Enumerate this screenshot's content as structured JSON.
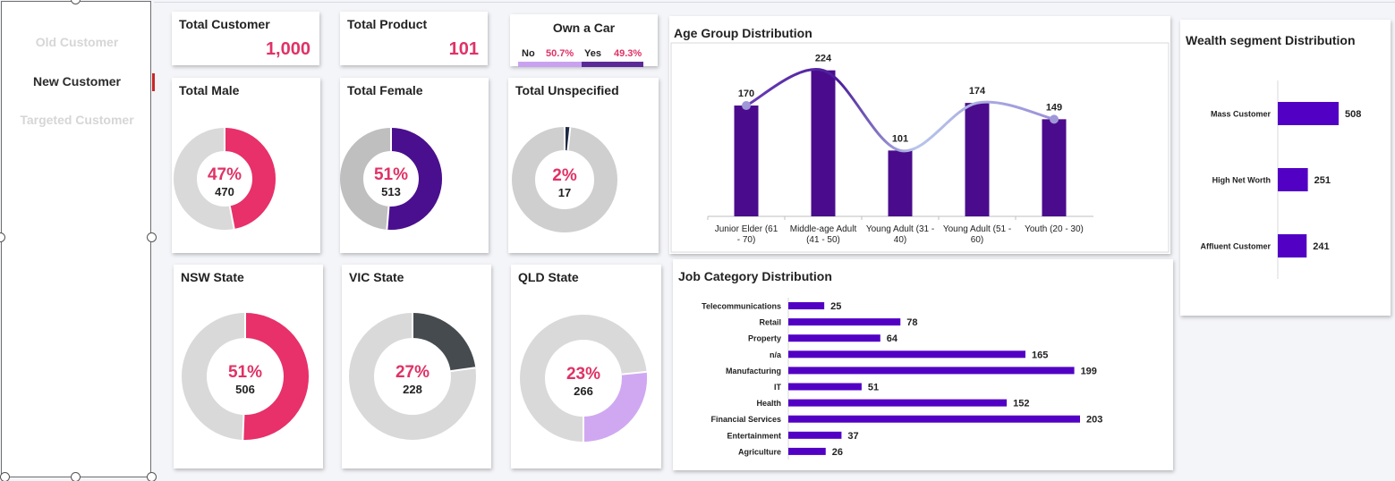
{
  "slicer": {
    "items": [
      {
        "label": "Old Customer",
        "state": "unselected"
      },
      {
        "label": "New Customer",
        "state": "selected"
      },
      {
        "label": "Targeted Customer",
        "state": "unselected"
      }
    ]
  },
  "kpis": {
    "total_customer": {
      "title": "Total Customer",
      "value": "1,000"
    },
    "total_product": {
      "title": "Total Product",
      "value": "101"
    }
  },
  "car": {
    "title": "Own a Car",
    "no_label": "No",
    "no_pct": "50.7%",
    "yes_label": "Yes",
    "yes_pct": "49.3%",
    "no_value": 50.7,
    "yes_value": 49.3
  },
  "donuts": {
    "male": {
      "title": "Total Male",
      "pct": "47%",
      "count": "470",
      "fraction": 0.47,
      "color": "#e8306a",
      "rest": "#d9d9d9"
    },
    "female": {
      "title": "Total Female",
      "pct": "51%",
      "count": "513",
      "fraction": 0.513,
      "color": "#4a0f8f",
      "rest": "#bfbfbf"
    },
    "unspecified": {
      "title": "Total Unspecified",
      "pct": "2%",
      "count": "17",
      "fraction": 0.017,
      "color": "#1f2a44",
      "rest": "#cfcfcf"
    },
    "nsw": {
      "title": "NSW State",
      "pct": "51%",
      "count": "506",
      "fraction": 0.506,
      "color": "#e8306a",
      "rest": "#d9d9d9"
    },
    "vic": {
      "title": "VIC State",
      "pct": "27%",
      "count": "228",
      "fraction": 0.228,
      "color": "#464b4f",
      "rest": "#d9d9d9"
    },
    "qld": {
      "title": "QLD State",
      "pct": "23%",
      "count": "266",
      "fraction": 0.266,
      "color": "#d0a8f2",
      "rest": "#d9d9d9",
      "reverse": true
    }
  },
  "chart_data": [
    {
      "type": "bar",
      "title": "Age Group Distribution",
      "categories": [
        "Junior Elder (61 - 70)",
        "Middle-age Adult (41 - 50)",
        "Young Adult (31 - 40)",
        "Young Adult (51 - 60)",
        "Youth (20 - 30)"
      ],
      "values": [
        170,
        224,
        101,
        174,
        149
      ],
      "overlay": "line",
      "bar_color": "#4a0c8c",
      "line_color": "#7c50c4"
    },
    {
      "type": "bar",
      "orientation": "horizontal",
      "title": "Job Category Distribution",
      "categories": [
        "Telecommunications",
        "Retail",
        "Property",
        "n/a",
        "Manufacturing",
        "IT",
        "Health",
        "Financial Services",
        "Entertainment",
        "Agriculture"
      ],
      "values": [
        25,
        78,
        64,
        165,
        199,
        51,
        152,
        203,
        37,
        26
      ],
      "bar_color": "#5200c4"
    },
    {
      "type": "bar",
      "orientation": "horizontal",
      "title": "Wealth segment Distribution",
      "categories": [
        "Mass Customer",
        "High Net Worth",
        "Affluent Customer"
      ],
      "values": [
        508,
        251,
        241
      ],
      "bar_color": "#5200c4"
    }
  ]
}
